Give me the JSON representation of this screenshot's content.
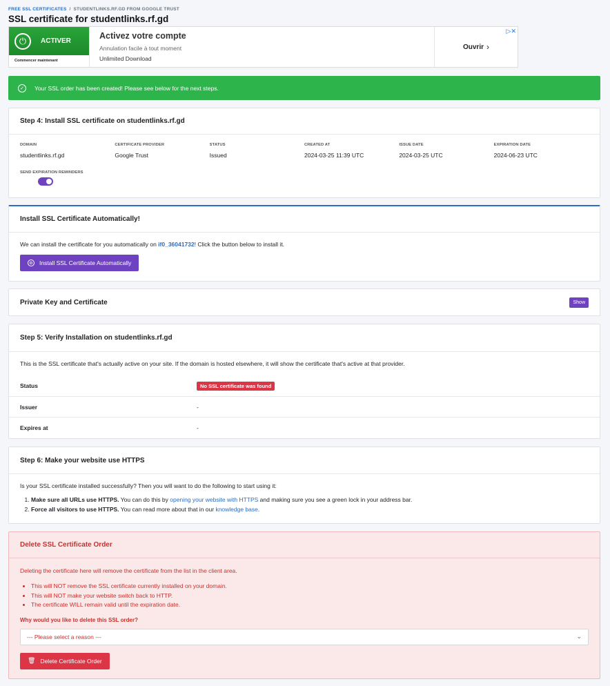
{
  "breadcrumb": {
    "root": "FREE SSL CERTIFICATES",
    "separator": "/",
    "current": "STUDENTLINKS.RF.GD FROM GOOGLE TRUST"
  },
  "page_title": "SSL certificate for studentlinks.rf.gd",
  "ad": {
    "button_text": "ACTIVER",
    "sub_text": "Commencer maintenant",
    "headline": "Activez votre compte",
    "line1": "Annulation facile à tout moment",
    "line2": "Unlimited Download",
    "cta": "Ouvrir"
  },
  "alert": {
    "text": "Your SSL order has been created! Please see below for the next steps."
  },
  "step4": {
    "title": "Step 4: Install SSL certificate on studentlinks.rf.gd",
    "fields": [
      {
        "label": "DOMAIN",
        "value": "studentlinks.rf.gd"
      },
      {
        "label": "CERTIFICATE PROVIDER",
        "value": "Google Trust"
      },
      {
        "label": "STATUS",
        "value": "Issued"
      },
      {
        "label": "CREATED AT",
        "value": "2024-03-25 11:39 UTC"
      },
      {
        "label": "ISSUE DATE",
        "value": "2024-03-25 UTC"
      },
      {
        "label": "EXPIRATION DATE",
        "value": "2024-06-23 UTC"
      }
    ],
    "reminder_label": "SEND EXPIRATION REMINDERS"
  },
  "auto_install": {
    "title": "Install SSL Certificate Automatically!",
    "text_before": "We can install the certificate for you automatically on ",
    "account": "if0_36041732",
    "text_after": "! Click the button below to install it.",
    "button": "Install SSL Certificate Automatically"
  },
  "private_key": {
    "title": "Private Key and Certificate",
    "button": "Show"
  },
  "step5": {
    "title": "Step 5: Verify Installation on studentlinks.rf.gd",
    "intro": "This is the SSL certificate that's actually active on your site. If the domain is hosted elsewhere, it will show the certificate that's active at that provider.",
    "status_label": "Status",
    "status_value": "No SSL certificate was found",
    "issuer_label": "Issuer",
    "issuer_value": "-",
    "expires_label": "Expires at",
    "expires_value": "-"
  },
  "step6": {
    "title": "Step 6: Make your website use HTTPS",
    "intro": "Is your SSL certificate installed successfully? Then you will want to do the following to start using it:",
    "item1_bold": "Make sure all URLs use HTTPS.",
    "item1_text": " You can do this by ",
    "item1_link": "opening your website with HTTPS",
    "item1_tail": " and making sure you see a green lock in your address bar.",
    "item2_bold": "Force all visitors to use HTTPS.",
    "item2_text": " You can read more about that in our ",
    "item2_link": "knowledge base",
    "item2_tail": "."
  },
  "delete": {
    "title": "Delete SSL Certificate Order",
    "intro": "Deleting the certificate here will remove the certificate from the list in the client area.",
    "bullets": [
      "This will NOT remove the SSL certificate currently installed on your domain.",
      "This will NOT make your website switch back to HTTP.",
      "The certificate WILL remain valid until the expiration date."
    ],
    "question": "Why would you like to delete this SSL order?",
    "select_placeholder": "--- Please select a reason ---",
    "button": "Delete Certificate Order"
  },
  "colors": {
    "success": "#2db54c",
    "accent": "#6f42c1",
    "danger": "#dc3545",
    "link": "#2a6cc4"
  }
}
